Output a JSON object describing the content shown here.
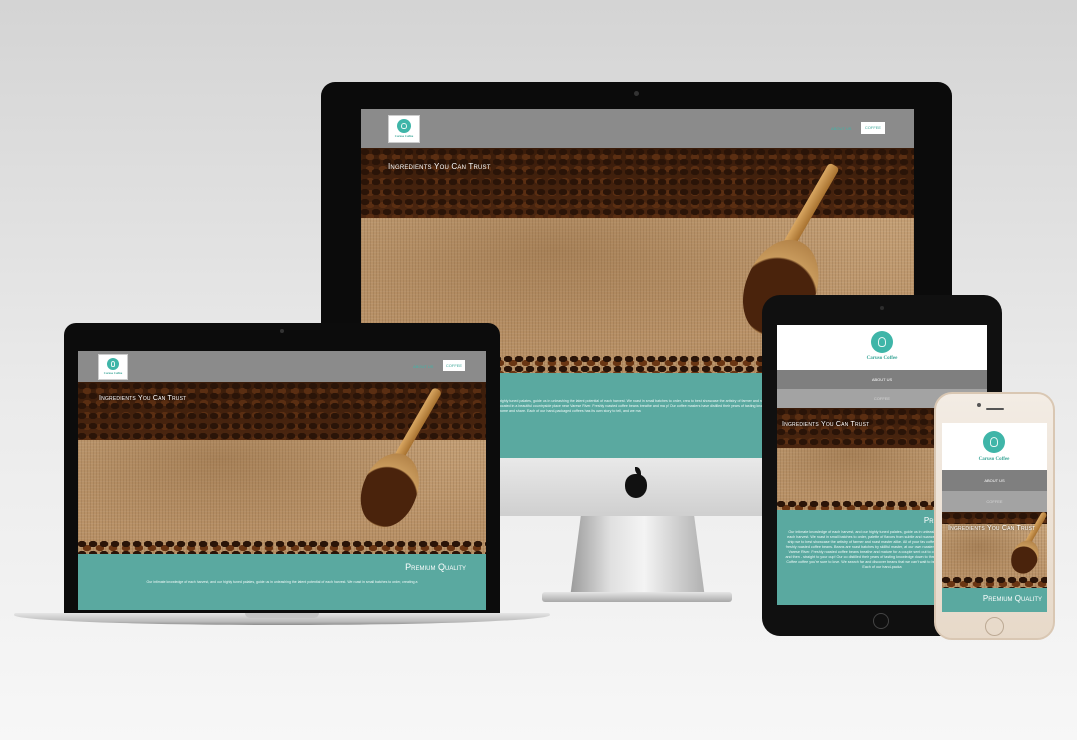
{
  "site": {
    "brand": "Caruso Coffee",
    "nav_about": "ABOUT US",
    "nav_coffee": "COFFEE",
    "hero_title": "Ingredients You Can Trust",
    "section_title": "Premium Quality",
    "paragraph_desktop": "highly tuned palates, guide us in unleashing the latent potential of each harvest. We roast in small batches to order, crea to best showcase the artistry of farmer and roast master alike. All of your favorite Caruso Coffee coffees are prepared on our own roastery, located in a beautiful countryside place near Varese River. Freshly roasted coffee beans breathe and ma p! Our coffee masters have distilled their years of tasting knowledge down to three simple questions to help you find a C that we can't wait to bring them home and share. Each of our hand-packaged coffees has its own story to tell, and we ma",
    "paragraph_laptop": "Our intimate knowledge of each harvest, and our highly tuned palates, guide us in unleashing the latent potential of each harvest. We roast in small batches to order, creating a",
    "paragraph_tablet": "Our intimate knowledge of each harvest, and our highly tuned palates, guide us in unleashing the latent potential of each harvest. We roast in small batches to order, palette of flavors from subtle and nuanced, to bold and brassy, and ship we to best showcase the artistry of farmer and roast master alike. All of your fav coffees are prepared only from freshly roasted coffee beans. Beans are roast batches by skillful master, at our own roastery, located in a beautiful cou Varese River. Freshly roasted coffee beans breathe and mature for a couple sent out to our Caruso Coffee location and then - straight to your cup! Our co distilled their years of tasting knowledge down to three simple questions Caruso Coffee coffee you're sure to love. We search far and discover beans that we can't wait to bring them home and share. Each of our hand-packa"
  },
  "colors": {
    "teal": "#5aa9a0",
    "header_gray": "#8b8b8b",
    "accent": "#3fb5a8"
  },
  "devices": [
    "desktop-imac",
    "laptop-macbook",
    "tablet-ipad",
    "phone-iphone"
  ]
}
